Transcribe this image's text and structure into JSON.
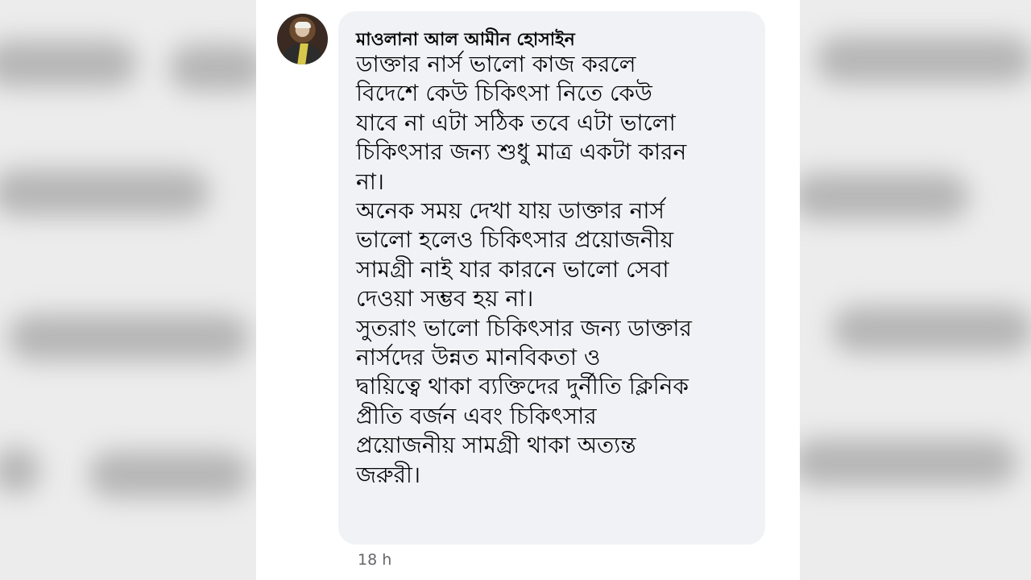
{
  "comment": {
    "author": "মাওলানা আল আমীন হোসাইন",
    "lines": [
      "ডাক্তার নার্স ভালো কাজ করলে",
      "বিদেশে কেউ চিকিৎসা নিতে কেউ",
      "যাবে না এটা সঠিক তবে এটা ভালো",
      "চিকিৎসার জন্য শুধু মাত্র একটা কারন",
      "না।",
      "অনেক সময় দেখা যায় ডাক্তার নার্স",
      "ভালো হলেও চিকিৎসার প্রয়োজনীয়",
      "সামগ্রী নাই যার কারনে ভালো সেবা",
      "দেওয়া সম্ভব হয় না।",
      "সুতরাং ভালো চিকিৎসার জন্য ডাক্তার",
      "নার্সদের উন্নত মানবিকতা ও",
      "দ্বায়িত্বে থাকা ব্যক্তিদের দুর্নীতি ক্লিনিক",
      "প্রীতি বর্জন এবং চিকিৎসার",
      "প্রয়োজনীয় সামগ্রী থাকা অত্যন্ত",
      "জরুরী।"
    ],
    "timestamp": "18 h"
  },
  "icons": {
    "avatar": "user-avatar-photo"
  },
  "colors": {
    "bubble_background": "#f0f2f5",
    "text": "#050505",
    "timestamp": "#65676b"
  }
}
